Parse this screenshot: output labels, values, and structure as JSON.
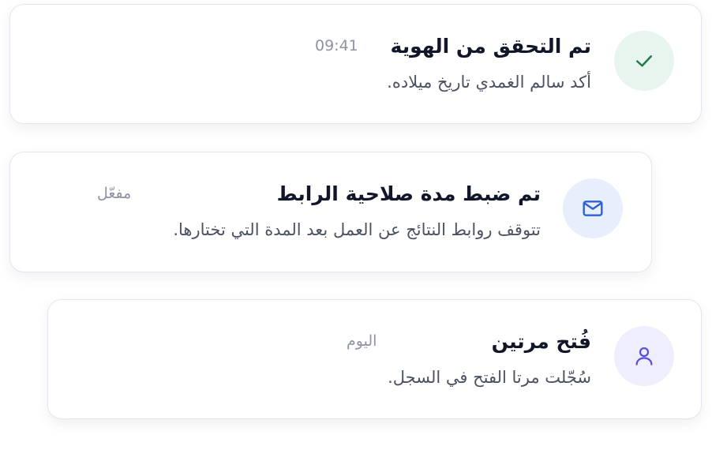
{
  "notifications": [
    {
      "title": "تم التحقق من الهوية",
      "description": "أكد سالم الغمدي تاريخ ميلاده.",
      "meta": "09:41",
      "icon": "check-icon",
      "icon_bg": "#e7f5ee",
      "icon_color": "#1f7a4d"
    },
    {
      "title": "تم ضبط مدة صلاحية الرابط",
      "description": "تتوقف روابط النتائج عن العمل بعد المدة التي تختارها.",
      "meta": "مفعّل",
      "icon": "mail-icon",
      "icon_bg": "#e8effc",
      "icon_color": "#2f5fd6"
    },
    {
      "title": "فُتح مرتين",
      "description": "سُجّلت مرتا الفتح في السجل.",
      "meta": "اليوم",
      "icon": "user-icon",
      "icon_bg": "#eeeefc",
      "icon_color": "#5a4fd8"
    }
  ]
}
